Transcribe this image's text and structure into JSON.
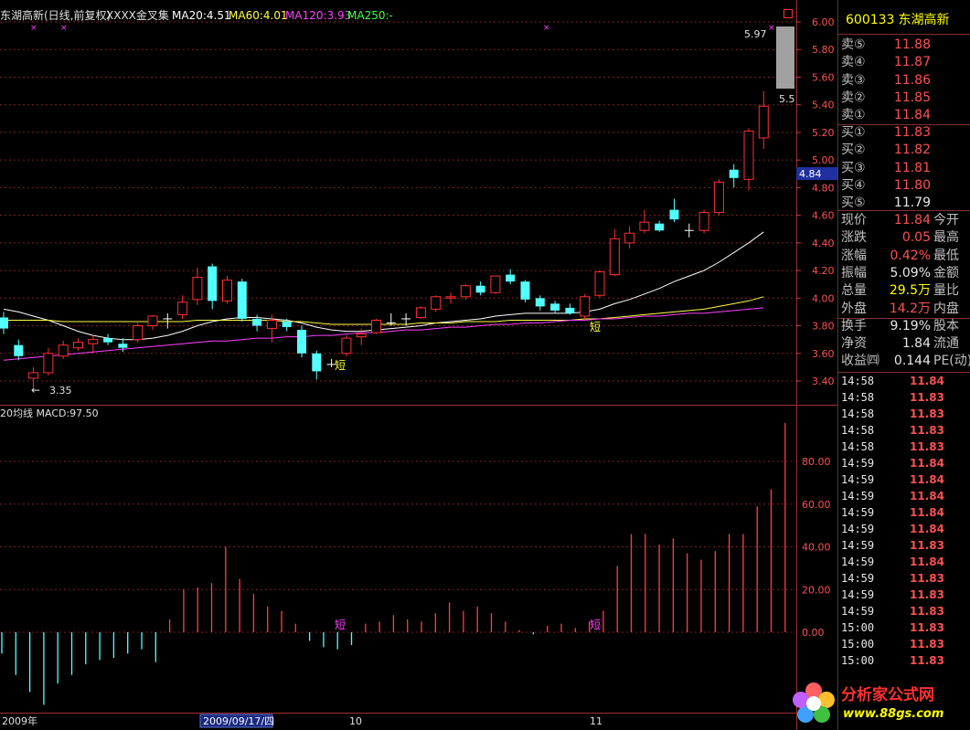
{
  "chart_header": {
    "title": "东湖高新(日线,前复权)",
    "indicator": "XXXX金叉集",
    "ma20": "MA20:4.51",
    "ma60": "MA60:4.01",
    "ma120": "MA120:3.93",
    "ma250": "MA250:-"
  },
  "macd_header": "20均线  MACD:97.50",
  "price_axis": [
    "6.00",
    "5.80",
    "5.60",
    "5.40",
    "5.20",
    "5.00",
    "4.80",
    "4.60",
    "4.40",
    "4.20",
    "4.00",
    "3.80",
    "3.60",
    "3.40"
  ],
  "current_price_tag": "4.84",
  "max_label": "5.97",
  "max_label_right": "5.5",
  "min_label": "3.35",
  "short_marks": [
    "短",
    "短"
  ],
  "macd_axis": [
    "80.00",
    "60.00",
    "40.00",
    "20.00",
    "0.00"
  ],
  "date_axis": {
    "year": "2009年",
    "cursor_date": "2009/09/17/四",
    "m10": "10",
    "m11": "11"
  },
  "colors": {
    "up": "#ff3030",
    "down": "#54ffff",
    "ma_white": "#ffffff",
    "ma_yellow": "#ffff40",
    "ma_magenta": "#ff40ff",
    "grid": "#802020"
  },
  "chart_data": {
    "type": "candlestick",
    "price_axis_range": [
      3.35,
      6.0
    ],
    "candles": [
      {
        "o": 3.86,
        "c": 3.78,
        "h": 3.9,
        "l": 3.74
      },
      {
        "o": 3.66,
        "c": 3.58,
        "h": 3.7,
        "l": 3.55
      },
      {
        "o": 3.42,
        "c": 3.46,
        "h": 3.5,
        "l": 3.35
      },
      {
        "o": 3.46,
        "c": 3.6,
        "h": 3.64,
        "l": 3.44
      },
      {
        "o": 3.58,
        "c": 3.66,
        "h": 3.69,
        "l": 3.56
      },
      {
        "o": 3.64,
        "c": 3.68,
        "h": 3.71,
        "l": 3.62
      },
      {
        "o": 3.67,
        "c": 3.7,
        "h": 3.73,
        "l": 3.6
      },
      {
        "o": 3.71,
        "c": 3.68,
        "h": 3.74,
        "l": 3.66
      },
      {
        "o": 3.67,
        "c": 3.64,
        "h": 3.71,
        "l": 3.61
      },
      {
        "o": 3.7,
        "c": 3.8,
        "h": 3.82,
        "l": 3.68
      },
      {
        "o": 3.8,
        "c": 3.87,
        "h": 3.88,
        "l": 3.77
      },
      {
        "o": 3.85,
        "c": 3.85,
        "h": 3.89,
        "l": 3.78
      },
      {
        "o": 3.88,
        "c": 3.97,
        "h": 4.02,
        "l": 3.85
      },
      {
        "o": 3.99,
        "c": 4.15,
        "h": 4.22,
        "l": 3.95
      },
      {
        "o": 4.23,
        "c": 3.98,
        "h": 4.25,
        "l": 3.92
      },
      {
        "o": 3.98,
        "c": 4.13,
        "h": 4.16,
        "l": 3.96
      },
      {
        "o": 4.12,
        "c": 3.85,
        "h": 4.14,
        "l": 3.83
      },
      {
        "o": 3.85,
        "c": 3.8,
        "h": 3.88,
        "l": 3.76
      },
      {
        "o": 3.78,
        "c": 3.84,
        "h": 3.88,
        "l": 3.68
      },
      {
        "o": 3.83,
        "c": 3.79,
        "h": 3.85,
        "l": 3.76
      },
      {
        "o": 3.77,
        "c": 3.6,
        "h": 3.8,
        "l": 3.57
      },
      {
        "o": 3.6,
        "c": 3.47,
        "h": 3.62,
        "l": 3.41
      },
      {
        "o": 3.52,
        "c": 3.52,
        "h": 3.56,
        "l": 3.5
      },
      {
        "o": 3.6,
        "c": 3.71,
        "h": 3.73,
        "l": 3.58
      },
      {
        "o": 3.72,
        "c": 3.74,
        "h": 3.78,
        "l": 3.66
      },
      {
        "o": 3.75,
        "c": 3.84,
        "h": 3.85,
        "l": 3.74
      },
      {
        "o": 3.82,
        "c": 3.82,
        "h": 3.89,
        "l": 3.8
      },
      {
        "o": 3.85,
        "c": 3.85,
        "h": 3.89,
        "l": 3.8
      },
      {
        "o": 3.86,
        "c": 3.93,
        "h": 3.94,
        "l": 3.85
      },
      {
        "o": 3.92,
        "c": 4.01,
        "h": 4.02,
        "l": 3.9
      },
      {
        "o": 4.0,
        "c": 4.01,
        "h": 4.04,
        "l": 3.96
      },
      {
        "o": 4.01,
        "c": 4.09,
        "h": 4.1,
        "l": 3.99
      },
      {
        "o": 4.09,
        "c": 4.04,
        "h": 4.12,
        "l": 4.02
      },
      {
        "o": 4.04,
        "c": 4.16,
        "h": 4.16,
        "l": 4.03
      },
      {
        "o": 4.17,
        "c": 4.12,
        "h": 4.21,
        "l": 4.1
      },
      {
        "o": 4.12,
        "c": 3.99,
        "h": 4.13,
        "l": 3.97
      },
      {
        "o": 4.0,
        "c": 3.94,
        "h": 4.02,
        "l": 3.91
      },
      {
        "o": 3.96,
        "c": 3.91,
        "h": 3.98,
        "l": 3.89
      },
      {
        "o": 3.93,
        "c": 3.89,
        "h": 3.96,
        "l": 3.88
      },
      {
        "o": 3.87,
        "c": 4.01,
        "h": 4.03,
        "l": 3.85
      },
      {
        "o": 4.02,
        "c": 4.19,
        "h": 4.2,
        "l": 4.0
      },
      {
        "o": 4.17,
        "c": 4.43,
        "h": 4.5,
        "l": 4.16
      },
      {
        "o": 4.4,
        "c": 4.47,
        "h": 4.52,
        "l": 4.36
      },
      {
        "o": 4.49,
        "c": 4.55,
        "h": 4.64,
        "l": 4.47
      },
      {
        "o": 4.54,
        "c": 4.49,
        "h": 4.56,
        "l": 4.48
      },
      {
        "o": 4.64,
        "c": 4.57,
        "h": 4.72,
        "l": 4.55
      },
      {
        "o": 4.49,
        "c": 4.49,
        "h": 4.54,
        "l": 4.44
      },
      {
        "o": 4.49,
        "c": 4.62,
        "h": 4.64,
        "l": 4.47
      },
      {
        "o": 4.62,
        "c": 4.84,
        "h": 4.86,
        "l": 4.6
      },
      {
        "o": 4.93,
        "c": 4.87,
        "h": 4.97,
        "l": 4.8
      },
      {
        "o": 4.86,
        "c": 5.21,
        "h": 5.23,
        "l": 4.78
      },
      {
        "o": 5.16,
        "c": 5.39,
        "h": 5.5,
        "l": 5.08
      }
    ],
    "macd_axis_range": [
      -35,
      100
    ],
    "macd_bars": [
      -10,
      -20,
      -28,
      -34,
      -24,
      -20,
      -15,
      -13,
      -12,
      -10,
      -8,
      -14,
      6,
      20,
      21,
      23,
      40,
      25,
      18,
      12,
      10,
      4,
      -4,
      -7,
      -8,
      -6,
      4,
      5,
      8,
      6,
      5,
      9,
      14,
      10,
      12,
      9,
      5,
      1,
      -1,
      3,
      4,
      2,
      5,
      10,
      31,
      46,
      46,
      41,
      44,
      37,
      34,
      38,
      46,
      46,
      59,
      67,
      98
    ],
    "ma_series": [
      {
        "name": "MA20",
        "color": "#ffffff"
      },
      {
        "name": "MA60",
        "color": "#ffff40"
      },
      {
        "name": "MA120",
        "color": "#ff40ff"
      }
    ]
  },
  "right_panel": {
    "code": "600133",
    "name": "东湖高新",
    "sells": [
      {
        "label": "卖⑤",
        "price": "11.88"
      },
      {
        "label": "卖④",
        "price": "11.87"
      },
      {
        "label": "卖③",
        "price": "11.86"
      },
      {
        "label": "卖②",
        "price": "11.85"
      },
      {
        "label": "卖①",
        "price": "11.84"
      }
    ],
    "buys": [
      {
        "label": "买①",
        "price": "11.83"
      },
      {
        "label": "买②",
        "price": "11.82"
      },
      {
        "label": "买③",
        "price": "11.81"
      },
      {
        "label": "买④",
        "price": "11.80"
      },
      {
        "label": "买⑤",
        "price": "11.79"
      }
    ],
    "stats": [
      {
        "l": "现价",
        "v": "11.84",
        "r": "今开",
        "cls": "red"
      },
      {
        "l": "涨跌",
        "v": "0.05",
        "r": "最高",
        "cls": "red"
      },
      {
        "l": "涨幅",
        "v": "0.42%",
        "r": "最低",
        "cls": "red"
      },
      {
        "l": "振幅",
        "v": "5.09%",
        "r": "金额",
        "cls": ""
      },
      {
        "l": "总量",
        "v": "29.5万",
        "r": "量比",
        "cls": "yel"
      },
      {
        "l": "外盘",
        "v": "14.2万",
        "r": "内盘",
        "cls": "red"
      },
      {
        "l": "换手",
        "v": "9.19%",
        "r": "股本",
        "cls": ""
      },
      {
        "l": "净资",
        "v": "1.84",
        "r": "流通",
        "cls": ""
      },
      {
        "l": "收益㈣",
        "v": "0.144",
        "r": "PE(动)",
        "cls": ""
      }
    ],
    "ticks": [
      {
        "t": "14:58",
        "p": "11.84"
      },
      {
        "t": "14:58",
        "p": "11.83"
      },
      {
        "t": "14:58",
        "p": "11.83"
      },
      {
        "t": "14:58",
        "p": "11.83"
      },
      {
        "t": "14:58",
        "p": "11.83"
      },
      {
        "t": "14:59",
        "p": "11.84"
      },
      {
        "t": "14:59",
        "p": "11.84"
      },
      {
        "t": "14:59",
        "p": "11.84"
      },
      {
        "t": "14:59",
        "p": "11.84"
      },
      {
        "t": "14:59",
        "p": "11.84"
      },
      {
        "t": "14:59",
        "p": "11.83"
      },
      {
        "t": "14:59",
        "p": "11.84"
      },
      {
        "t": "14:59",
        "p": "11.83"
      },
      {
        "t": "14:59",
        "p": "11.83"
      },
      {
        "t": "14:59",
        "p": "11.83"
      },
      {
        "t": "15:00",
        "p": "11.83"
      },
      {
        "t": "15:00",
        "p": "11.83"
      },
      {
        "t": "15:00",
        "p": "11.83"
      }
    ]
  },
  "logo": {
    "text": "分析家公式网",
    "url": "www.88gs.com"
  }
}
